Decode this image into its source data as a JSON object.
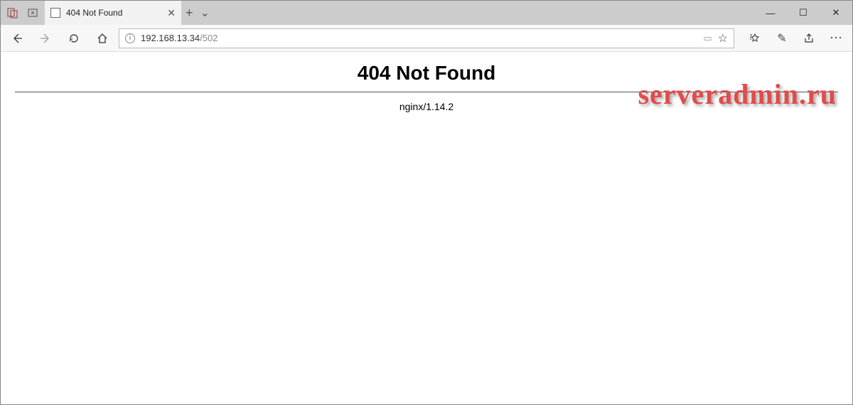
{
  "tab": {
    "title": "404 Not Found"
  },
  "address": {
    "host": "192.168.13.34",
    "path": "/502"
  },
  "page": {
    "heading": "404 Not Found",
    "server": "nginx/1.14.2"
  },
  "watermark": "serveradmin.ru",
  "glyph": {
    "plus": "+",
    "chevron_down": "⌄",
    "close": "✕",
    "minimize": "—",
    "maximize": "☐",
    "win_close": "✕",
    "more": "⋯",
    "star": "☆",
    "star_list": "≡☆",
    "pen": "✎",
    "share": "↗",
    "reading": "▭"
  }
}
